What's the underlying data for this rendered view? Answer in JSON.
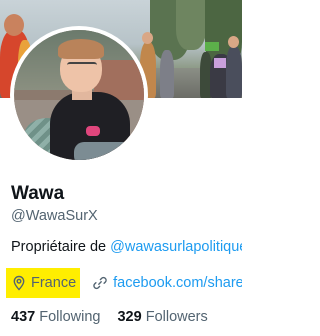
{
  "profile": {
    "display_name": "Wawa",
    "handle": "@WawaSurX",
    "bio_prefix": "Propriétaire de ",
    "bio_link": "@wawasurlapolitique",
    "location": "France",
    "website": "facebook.com/share",
    "following_count": "437",
    "following_label": "Following",
    "followers_count": "329",
    "followers_label": "Followers"
  },
  "icons": {
    "location": "map-pin-icon",
    "website": "link-icon"
  },
  "colors": {
    "link": "#1d9bf0",
    "secondary_text": "#536471",
    "primary_text": "#0f1419",
    "location_highlight": "#ffee00"
  }
}
